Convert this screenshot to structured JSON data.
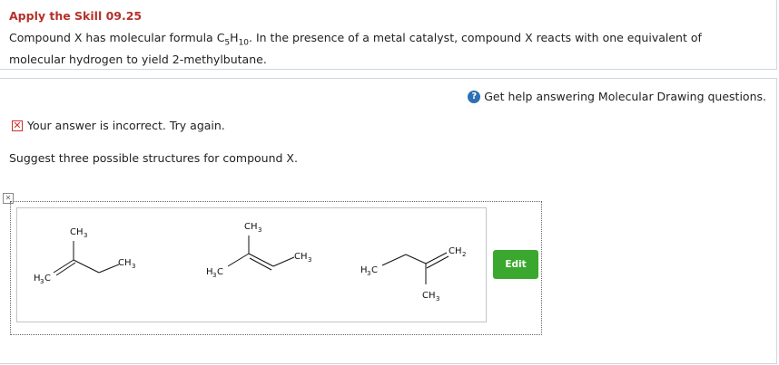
{
  "header": {
    "skill_title": "Apply the Skill 09.25",
    "question_before_formula": "Compound X has molecular formula C",
    "formula_sub1": "5",
    "formula_mid": "H",
    "formula_sub2": "10",
    "question_after_formula": ". In the presence of a metal catalyst, compound X reacts with one equivalent of molecular hydrogen to yield 2-methylbutane."
  },
  "help": {
    "icon": "question-circle-icon",
    "label": "Get help answering Molecular Drawing questions."
  },
  "feedback": {
    "icon": "x-mark-icon",
    "message": "Your answer is incorrect.  Try again."
  },
  "prompt": "Suggest three possible structures for compound X.",
  "edit_button": {
    "label": "Edit",
    "color": "#3aa82e"
  },
  "structures": [
    {
      "labels": [
        "CH",
        "3",
        "CH",
        "3",
        "H",
        "3",
        "C"
      ]
    },
    {
      "labels": [
        "CH",
        "3",
        "CH",
        "3",
        "H",
        "3",
        "C"
      ]
    },
    {
      "labels": [
        "CH",
        "2",
        "CH",
        "3",
        "H",
        "3",
        "C"
      ]
    }
  ],
  "colors": {
    "title": "#b5312b",
    "accent_blue": "#2d70b3",
    "error_red": "#c8302a"
  }
}
